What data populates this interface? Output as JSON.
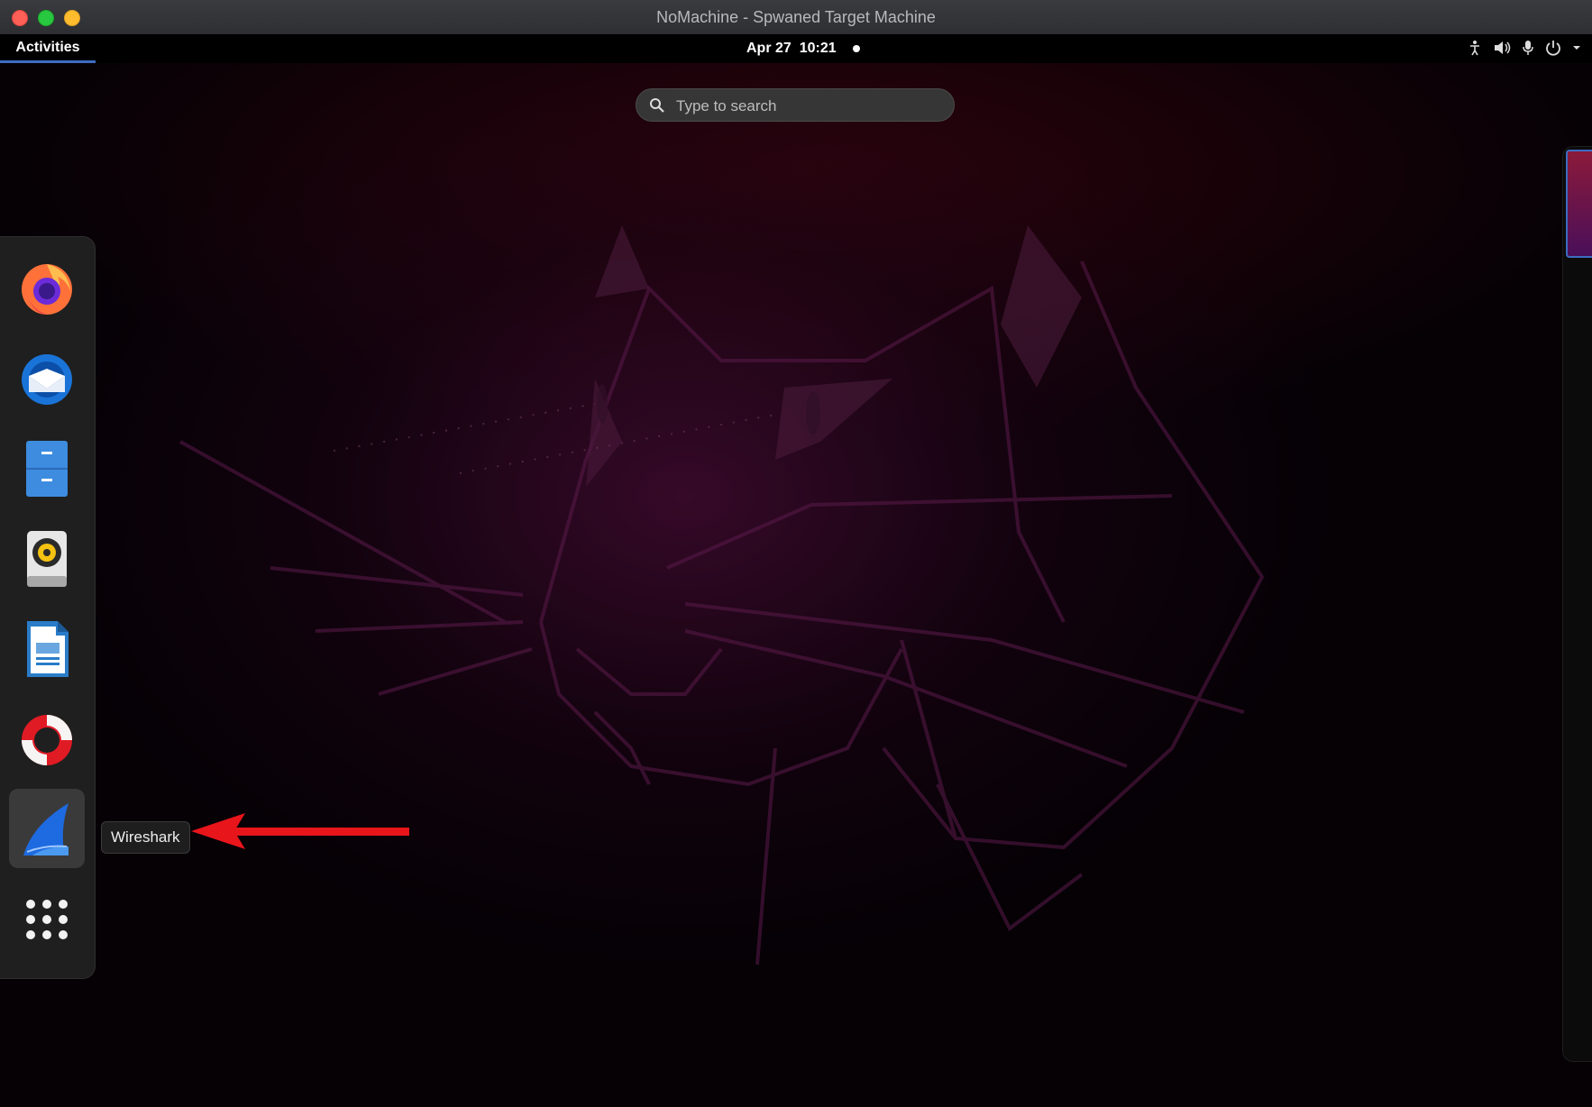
{
  "window": {
    "title": "NoMachine - Spwaned Target Machine",
    "buttons": [
      "close-button",
      "minimize-button",
      "maximize-button"
    ]
  },
  "topbar": {
    "activities_label": "Activities",
    "date": "Apr 27",
    "time": "10:21",
    "tray_icons": [
      "accessibility-icon",
      "volume-icon",
      "microphone-icon",
      "power-icon",
      "chevron-down-icon"
    ]
  },
  "search": {
    "placeholder": "Type to search"
  },
  "dock": {
    "items": [
      {
        "icon": "firefox-icon",
        "name": "Firefox"
      },
      {
        "icon": "thunderbird-icon",
        "name": "Thunderbird"
      },
      {
        "icon": "files-icon",
        "name": "Files"
      },
      {
        "icon": "rhythmbox-icon",
        "name": "Rhythmbox"
      },
      {
        "icon": "libreoffice-writer-icon",
        "name": "LibreOffice Writer"
      },
      {
        "icon": "help-icon",
        "name": "Help"
      },
      {
        "icon": "wireshark-icon",
        "name": "Wireshark",
        "active": true
      },
      {
        "icon": "app-grid-icon",
        "name": "Show Applications"
      }
    ],
    "tooltip": "Wireshark"
  },
  "annotation": {
    "arrow_color": "#e8151b"
  },
  "colors": {
    "accent": "#3e6cc0",
    "topbar_bg": "#000000",
    "dock_bg": "#1f1f1f"
  }
}
